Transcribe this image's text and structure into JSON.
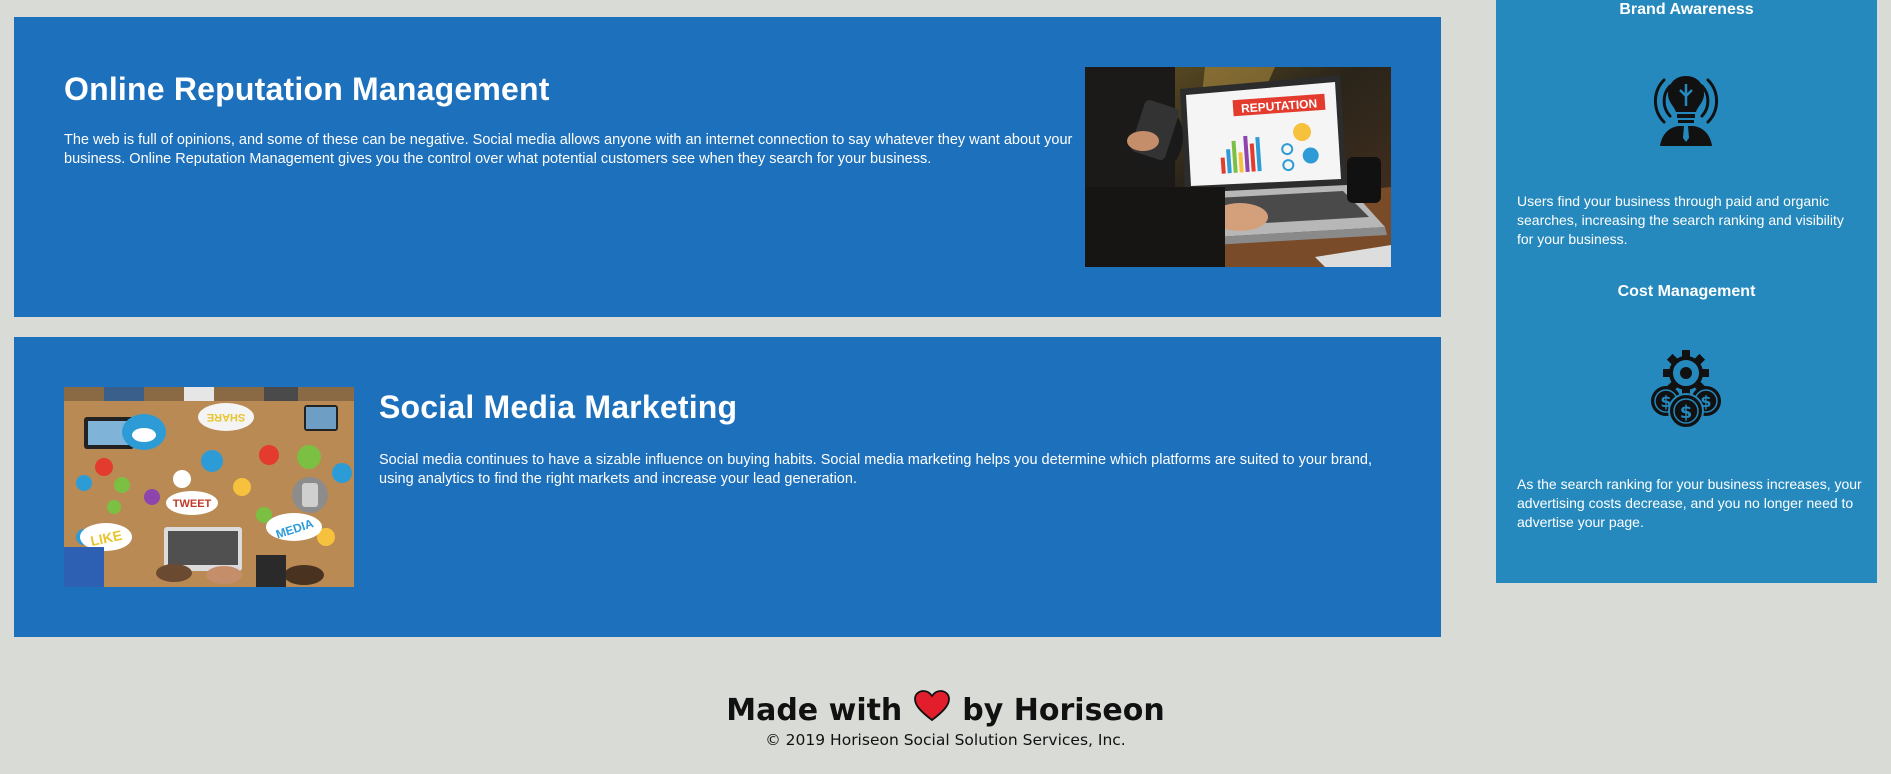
{
  "sections": {
    "orm": {
      "title": "Online Reputation Management",
      "text": "The web is full of opinions, and some of these can be negative. Social media allows anyone with an internet connection to say whatever they want about your business. Online Reputation Management gives you the control over what potential customers see when they search for your business.",
      "image_label": "REPUTATION"
    },
    "smm": {
      "title": "Social Media Marketing",
      "text": "Social media continues to have a sizable influence on buying habits. Social media marketing helps you determine which platforms are suited to your brand, using analytics to find the right markets and increase your lead generation.",
      "image_words": [
        "SHARE",
        "TWEET",
        "LIKE",
        "MEDIA"
      ]
    }
  },
  "sidebar": {
    "brand": {
      "title": "Brand Awareness",
      "icon": "lightbulb-person-icon",
      "text": "Users find your business through paid and organic searches, increasing the search ranking and visibility for your business."
    },
    "cost": {
      "title": "Cost Management",
      "icon": "gear-coins-icon",
      "text": "As the search ranking for your business increases, your advertising costs decrease, and you no longer need to advertise your page."
    }
  },
  "footer": {
    "made_prefix": "Made with",
    "made_suffix": "by Horiseon",
    "copyright": "© 2019 Horiseon Social Solution Services, Inc."
  },
  "colors": {
    "page_bg": "#d9dcd6",
    "card_bg": "#1d70bc",
    "sidebar_bg": "#2589bd",
    "heart": "#e21e2d"
  }
}
